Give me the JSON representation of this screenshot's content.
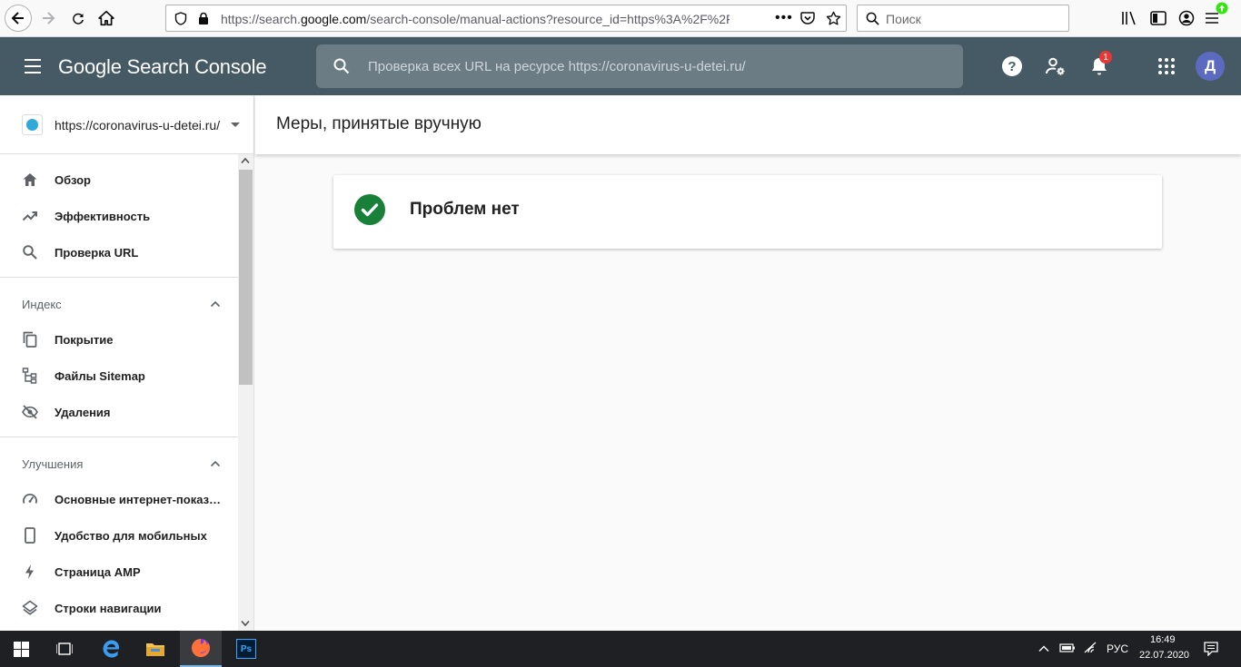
{
  "browser": {
    "url_plain": "https://search.",
    "url_domain": "google.com",
    "url_rest": "/search-console/manual-actions?resource_id=https%3A%2F%2Fcoro",
    "search_placeholder": "Поиск"
  },
  "header": {
    "app_title": "Google Search Console",
    "search_placeholder": "Проверка всех URL на ресурсе https://coronavirus-u-detei.ru/",
    "notification_count": "1",
    "avatar_letter": "Д"
  },
  "sidebar": {
    "property": "https://coronavirus-u-detei.ru/",
    "top_items": [
      {
        "label": "Обзор",
        "icon": "home-icon"
      },
      {
        "label": "Эффективность",
        "icon": "trending-up-icon"
      },
      {
        "label": "Проверка URL",
        "icon": "search-icon"
      }
    ],
    "index_title": "Индекс",
    "index_items": [
      {
        "label": "Покрытие",
        "icon": "copy-icon"
      },
      {
        "label": "Файлы Sitemap",
        "icon": "sitemap-icon"
      },
      {
        "label": "Удаления",
        "icon": "eye-off-icon"
      }
    ],
    "enhancements_title": "Улучшения",
    "enhancement_items": [
      {
        "label": "Основные интернет-показ…",
        "icon": "speedometer-icon"
      },
      {
        "label": "Удобство для мобильных",
        "icon": "phone-icon"
      },
      {
        "label": "Страница AMP",
        "icon": "bolt-icon"
      },
      {
        "label": "Строки навигации",
        "icon": "layers-icon"
      }
    ]
  },
  "main": {
    "page_title": "Меры, принятые вручную",
    "status_message": "Проблем нет"
  },
  "taskbar": {
    "language": "РУС",
    "time": "16:49",
    "date": "22.07.2020"
  },
  "colors": {
    "header_bg": "#455a64",
    "success": "#188038",
    "avatar": "#5c6bc0"
  }
}
